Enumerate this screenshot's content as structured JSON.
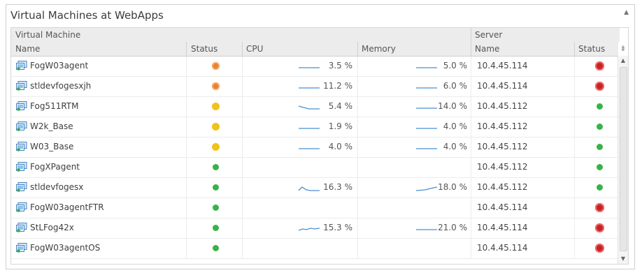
{
  "panel": {
    "title": "Virtual Machines at WebApps"
  },
  "headers": {
    "group_vm": "Virtual Machine",
    "group_server": "Server",
    "name": "Name",
    "status": "Status",
    "cpu": "CPU",
    "memory": "Memory",
    "server_name": "Name",
    "server_status": "Status"
  },
  "colors": {
    "orange": "#e9822b",
    "yellow": "#f1c21b",
    "green": "#36b34a",
    "red": "#cc2121",
    "spark": "#4a8fd1"
  },
  "rows": [
    {
      "name": "FogW03agent",
      "status": "orange",
      "cpu": "3.5 %",
      "cpu_spark": "flat",
      "memory": "5.0 %",
      "mem_spark": "flat",
      "server": "10.4.45.114",
      "server_status": "red"
    },
    {
      "name": "stldevfogesxjh",
      "status": "orange",
      "cpu": "11.2 %",
      "cpu_spark": "flat",
      "memory": "6.0 %",
      "mem_spark": "flat",
      "server": "10.4.45.114",
      "server_status": "red"
    },
    {
      "name": "Fog511RTM",
      "status": "yellow",
      "cpu": "5.4 %",
      "cpu_spark": "dip",
      "memory": "14.0 %",
      "mem_spark": "flat",
      "server": "10.4.45.112",
      "server_status": "green"
    },
    {
      "name": "W2k_Base",
      "status": "yellow",
      "cpu": "1.9 %",
      "cpu_spark": "flat",
      "memory": "4.0 %",
      "mem_spark": "flat",
      "server": "10.4.45.112",
      "server_status": "green"
    },
    {
      "name": "W03_Base",
      "status": "yellow",
      "cpu": "4.0 %",
      "cpu_spark": "flat",
      "memory": "4.0 %",
      "mem_spark": "flat",
      "server": "10.4.45.112",
      "server_status": "green"
    },
    {
      "name": "FogXPagent",
      "status": "green",
      "cpu": "",
      "cpu_spark": "",
      "memory": "",
      "mem_spark": "",
      "server": "10.4.45.112",
      "server_status": "green"
    },
    {
      "name": "stldevfogesx",
      "status": "green",
      "cpu": "16.3 %",
      "cpu_spark": "peak",
      "memory": "18.0 %",
      "mem_spark": "rise",
      "server": "10.4.45.112",
      "server_status": "green"
    },
    {
      "name": "FogW03agentFTR",
      "status": "green",
      "cpu": "",
      "cpu_spark": "",
      "memory": "",
      "mem_spark": "",
      "server": "10.4.45.114",
      "server_status": "red"
    },
    {
      "name": "StLFog42x",
      "status": "green",
      "cpu": "15.3 %",
      "cpu_spark": "wiggle",
      "memory": "21.0 %",
      "mem_spark": "flat",
      "server": "10.4.45.114",
      "server_status": "red"
    },
    {
      "name": "FogW03agentOS",
      "status": "green",
      "cpu": "",
      "cpu_spark": "",
      "memory": "",
      "mem_spark": "",
      "server": "10.4.45.114",
      "server_status": "red"
    }
  ]
}
